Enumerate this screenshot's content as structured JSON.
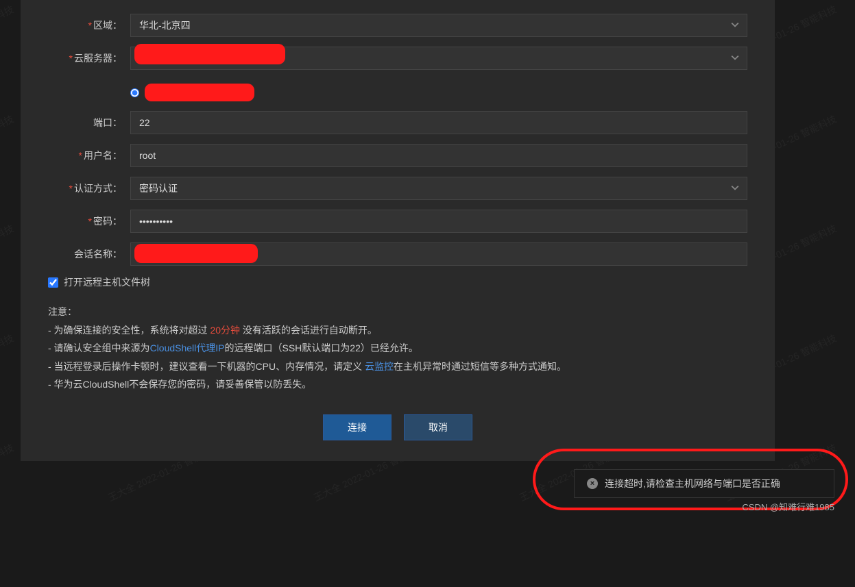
{
  "form": {
    "region": {
      "label": "区域：",
      "value": "华北-北京四"
    },
    "server": {
      "label": "云服务器：",
      "value": ""
    },
    "radio": {
      "label": ""
    },
    "port": {
      "label": "端口：",
      "value": "22"
    },
    "username": {
      "label": "用户名：",
      "value": "root"
    },
    "authmode": {
      "label": "认证方式：",
      "value": "密码认证"
    },
    "password": {
      "label": "密码：",
      "value": "••••••••••"
    },
    "session": {
      "label": "会话名称：",
      "value": ""
    }
  },
  "checkbox": {
    "label": "打开远程主机文件树"
  },
  "notice": {
    "title": "注意：",
    "line1a": "- 为确保连接的安全性，系统将对超过 ",
    "line1b": "20分钟",
    "line1c": " 没有活跃的会话进行自动断开。",
    "line2a": "- 请确认安全组中来源为",
    "line2b": "CloudShell代理IP",
    "line2c": "的远程端口（SSH默认端口为22）已经允许。",
    "line3a": "- 当远程登录后操作卡顿时，建议查看一下机器的CPU、内存情况，请定义 ",
    "line3b": "云监控",
    "line3c": "在主机异常时通过短信等多种方式通知。",
    "line4": "- 华为云CloudShell不会保存您的密码，请妥善保管以防丢失。"
  },
  "buttons": {
    "connect": "连接",
    "cancel": "取消"
  },
  "toast": {
    "icon": "×",
    "message": "连接超时,请检查主机网络与端口是否正确"
  },
  "csdn": "CSDN @知难行难1985",
  "watermark": "王大全 2022-01-26 智能科技"
}
